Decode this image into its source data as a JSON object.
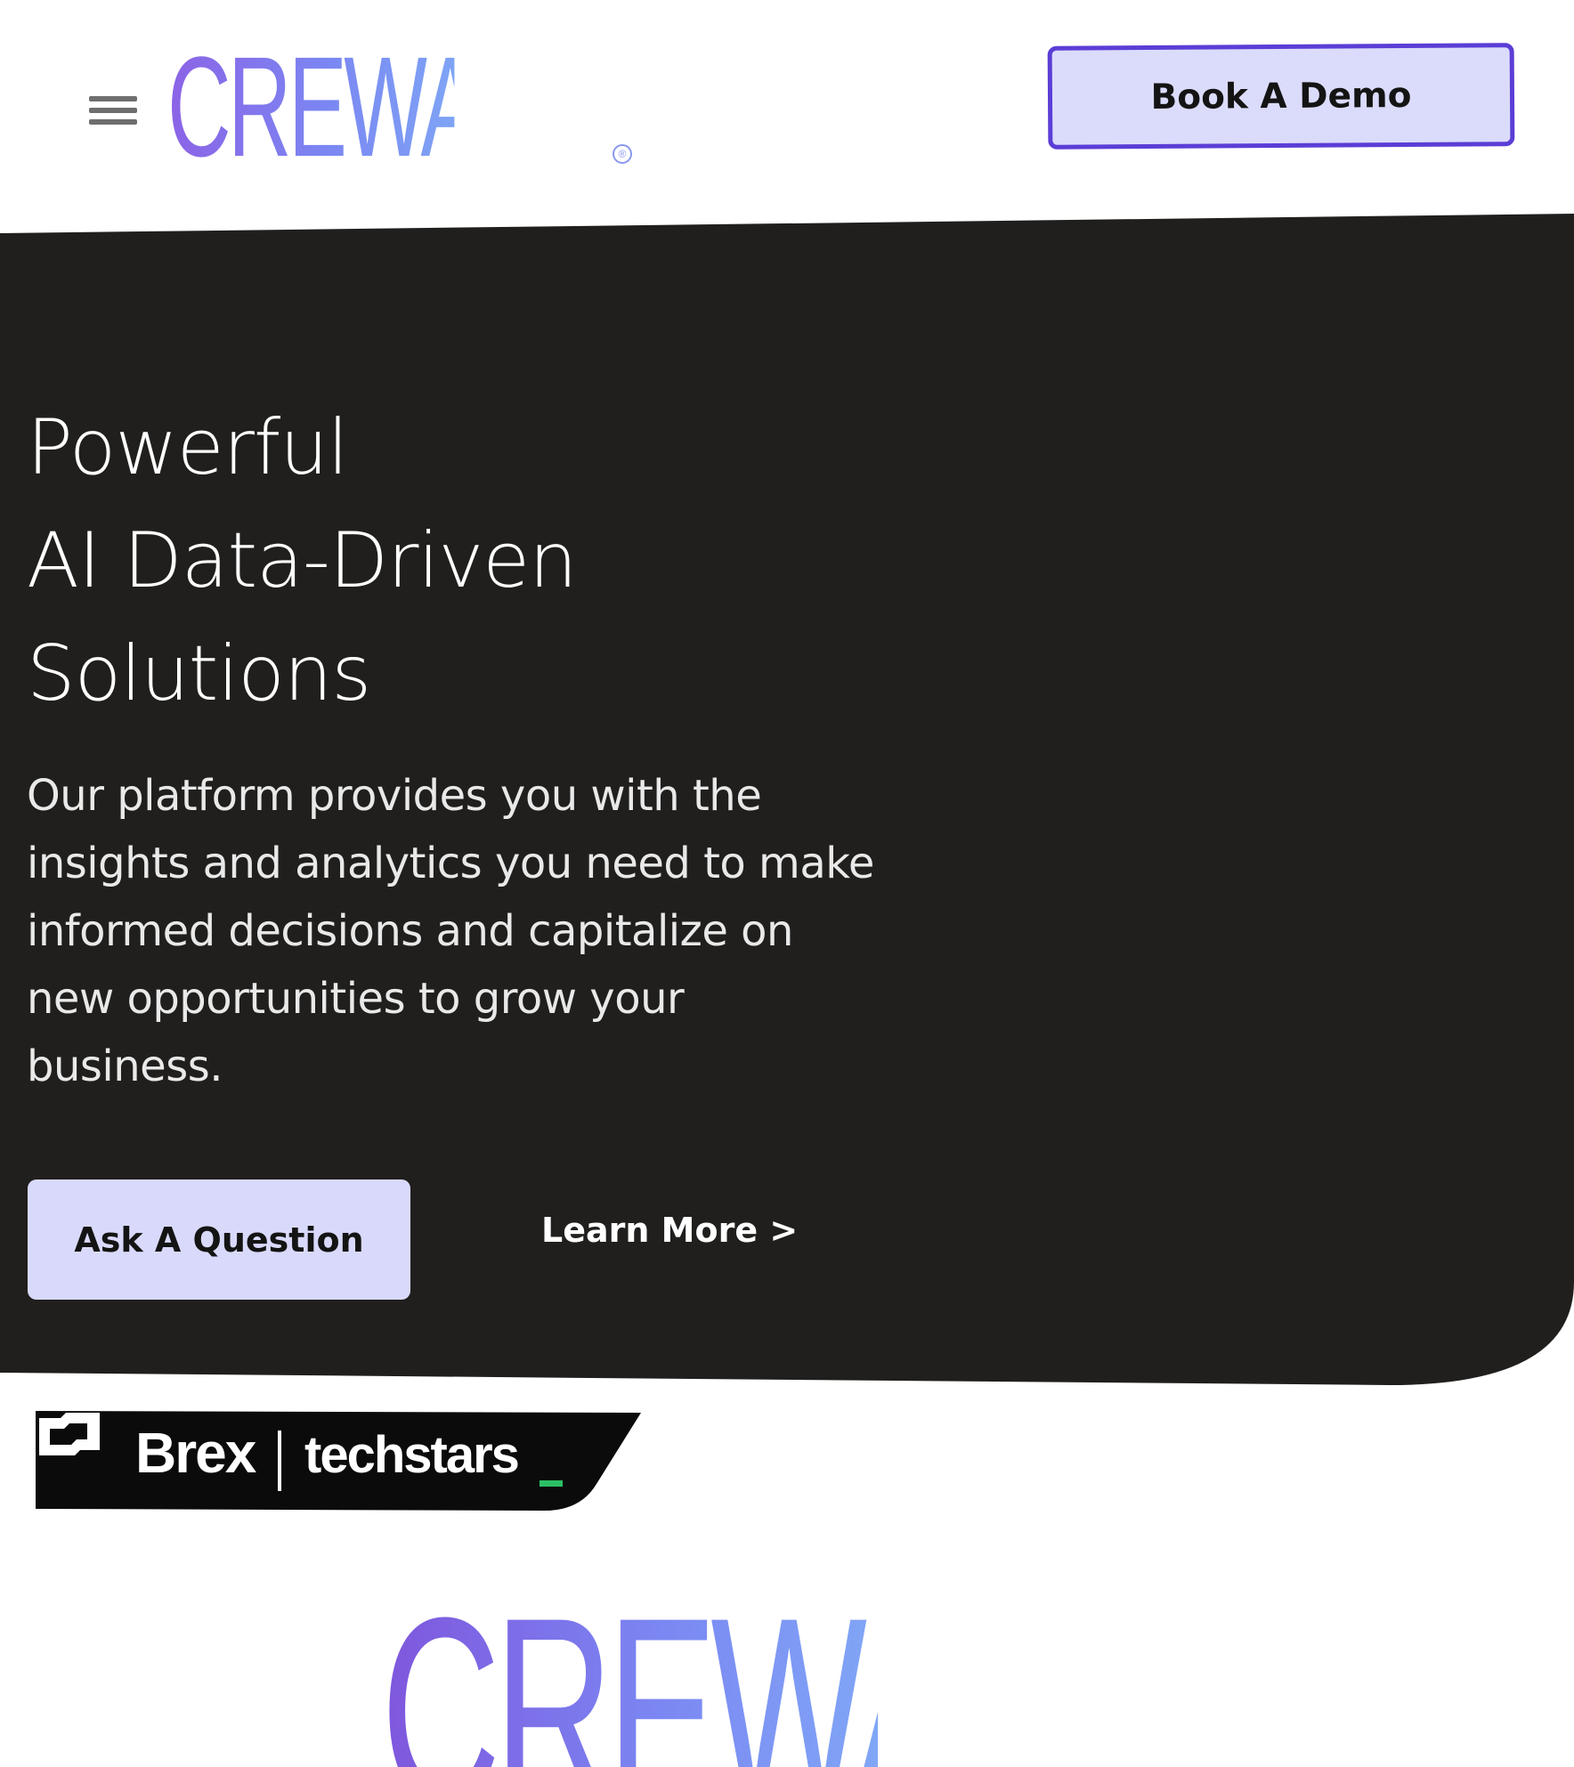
{
  "header": {
    "brand_name": "CREWASIS",
    "registered_mark": "®",
    "menu_icon": "hamburger-menu-icon",
    "book_demo_label": "Book A Demo"
  },
  "hero": {
    "headline_lines": [
      "Powerful",
      "AI Data-Driven",
      "Solutions"
    ],
    "description": "Our platform provides you with the insights and analytics you need to make informed decisions and capitalize on new opportunities to grow your business.",
    "ask_button_label": "Ask A Question",
    "learn_more_label": "Learn More >"
  },
  "sponsors": {
    "brex_label": "Brex",
    "techstars_label": "techstars"
  },
  "footer_brand": {
    "brand_name": "CREWASIS"
  },
  "colors": {
    "hero_background": "#201f1d",
    "brand_purple": "#8c63e6",
    "brand_blue": "#7ea4f5",
    "button_fill": "#dbdcfb",
    "button_border": "#5b3ed6",
    "techstars_green": "#2cc065"
  }
}
